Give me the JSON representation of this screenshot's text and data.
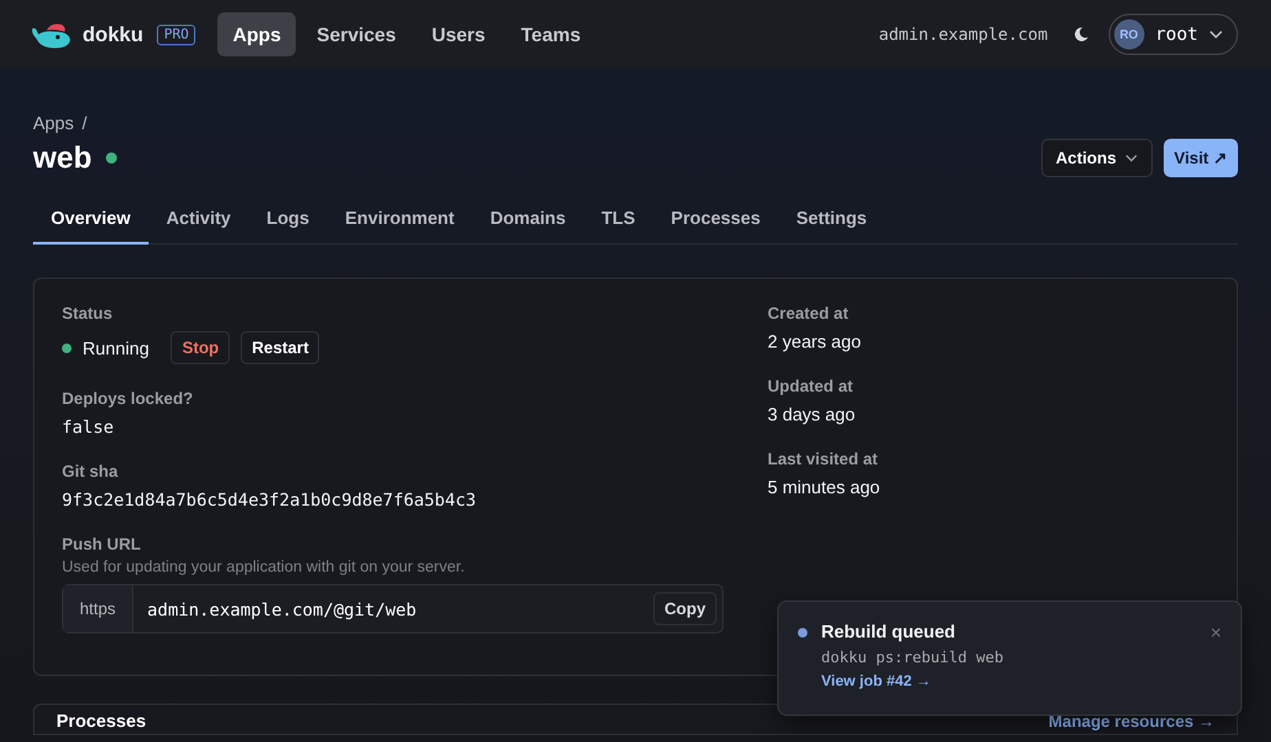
{
  "header": {
    "brand": "dokku",
    "badge": "PRO",
    "nav": [
      {
        "label": "Apps",
        "selected": true
      },
      {
        "label": "Services",
        "selected": false
      },
      {
        "label": "Users",
        "selected": false
      },
      {
        "label": "Teams",
        "selected": false
      }
    ],
    "host": "admin.example.com",
    "user": {
      "initials": "RO",
      "name": "root"
    }
  },
  "breadcrumb": [
    "Apps",
    "/"
  ],
  "app": {
    "name": "web",
    "actions": "Actions",
    "visit": "Visit ↗"
  },
  "tabs": [
    {
      "label": "Overview",
      "selected": true
    },
    {
      "label": "Activity",
      "selected": false
    },
    {
      "label": "Logs",
      "selected": false
    },
    {
      "label": "Environment",
      "selected": false
    },
    {
      "label": "Domains",
      "selected": false
    },
    {
      "label": "TLS",
      "selected": false
    },
    {
      "label": "Processes",
      "selected": false
    },
    {
      "label": "Settings",
      "selected": false
    }
  ],
  "overview": {
    "status": {
      "label": "Status",
      "value": "Running",
      "stop": "Stop",
      "restart": "Restart"
    },
    "left": [
      {
        "label": "Deploys locked?",
        "value": "false"
      },
      {
        "label": "Git sha",
        "value": "9f3c2e1d84a7b6c5d4e3f2a1b0c9d8e7f6a5b4c3"
      }
    ],
    "push": {
      "label": "Push URL",
      "hint": "Used for updating your application with git on your server.",
      "scheme": "https",
      "url": "admin.example.com/@git/web",
      "copy": "Copy"
    },
    "right": [
      {
        "label": "Created at",
        "value": "2 years ago"
      },
      {
        "label": "Updated at",
        "value": "3 days ago"
      },
      {
        "label": "Last visited at",
        "value": "5 minutes ago"
      }
    ]
  },
  "processes": {
    "title": "Processes",
    "link": "Manage resources →"
  },
  "toast": {
    "title": "Rebuild queued",
    "command": "dokku ps:rebuild web",
    "link": "View job #42 →",
    "close": "×"
  }
}
